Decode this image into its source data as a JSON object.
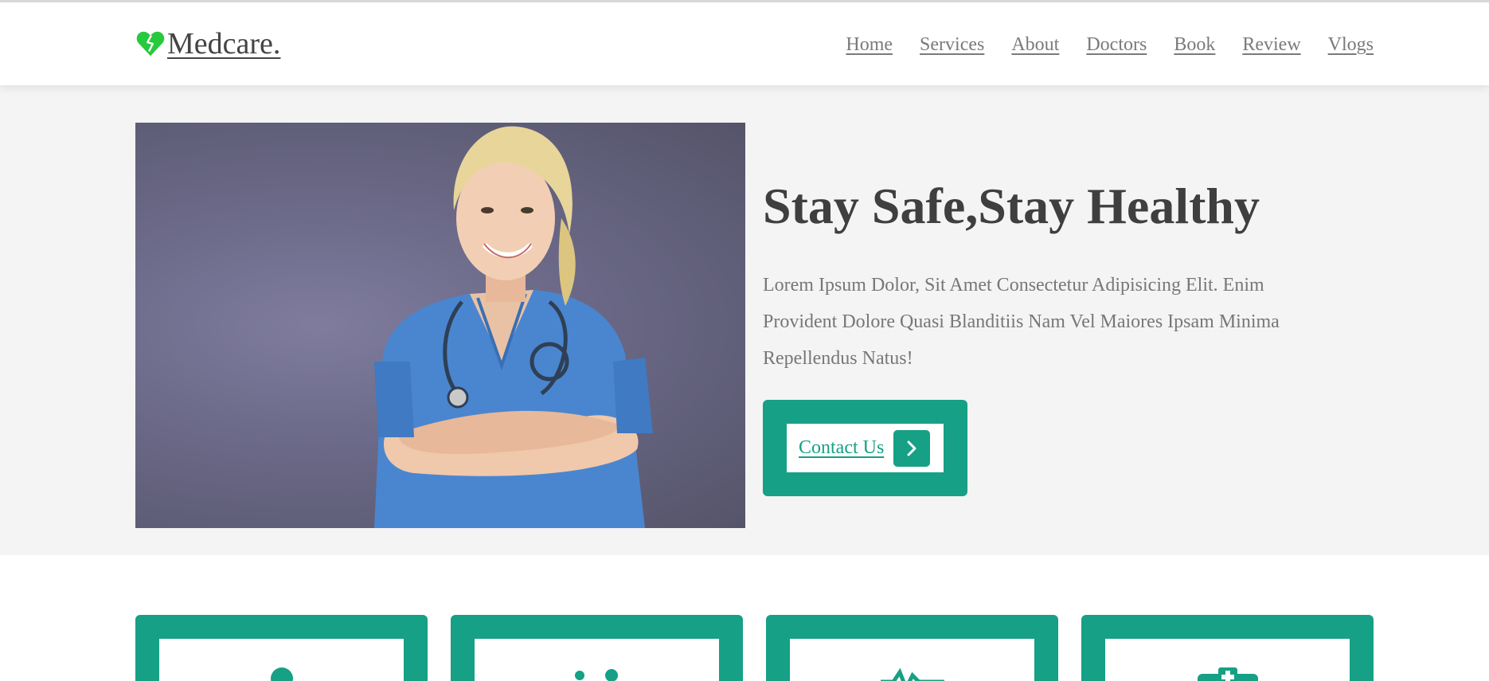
{
  "header": {
    "brand": "Medcare.",
    "logo_icon": "heart-broken-icon",
    "nav": [
      {
        "label": "Home"
      },
      {
        "label": "Services"
      },
      {
        "label": "About"
      },
      {
        "label": "Doctors"
      },
      {
        "label": "Book"
      },
      {
        "label": "Review"
      },
      {
        "label": "Vlogs"
      }
    ]
  },
  "hero": {
    "image_alt": "nurse-with-stethoscope-photo",
    "title": "Stay Safe,Stay Healthy",
    "text": "Lorem Ipsum Dolor, Sit Amet Consectetur Adipisicing Elit. Enim Provident Dolore Quasi Blanditiis Nam Vel Maiores Ipsam Minima Repellendus Natus!",
    "cta_label": "Contact Us",
    "cta_icon": "chevron-right-icon"
  },
  "cards": [
    {
      "icon": "user-doctor-icon"
    },
    {
      "icon": "users-icon"
    },
    {
      "icon": "heartbeat-icon"
    },
    {
      "icon": "hospital-icon"
    }
  ],
  "colors": {
    "accent": "#16a085",
    "logo_green": "#27c93f",
    "hero_bg": "#f4f4f4",
    "text_dark": "#3f3f3f",
    "text_muted": "#777777"
  }
}
